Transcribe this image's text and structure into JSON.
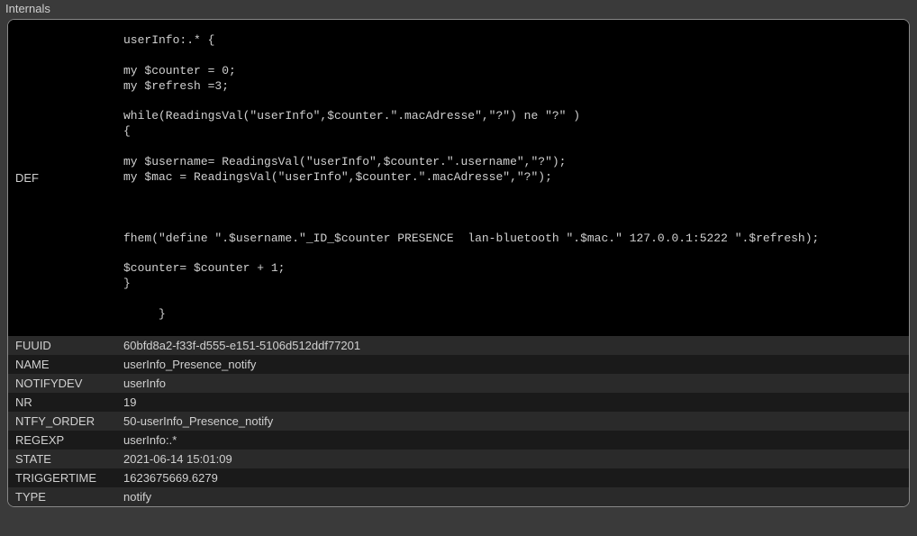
{
  "section_title": "Internals",
  "internals": {
    "def_label": "DEF",
    "def_code": "userInfo:.* {\n\nmy $counter = 0;\nmy $refresh =3;\n\nwhile(ReadingsVal(\"userInfo\",$counter.\".macAdresse\",\"?\") ne \"?\" )\n{\n\nmy $username= ReadingsVal(\"userInfo\",$counter.\".username\",\"?\");\nmy $mac = ReadingsVal(\"userInfo\",$counter.\".macAdresse\",\"?\");\n\n\n\nfhem(\"define \".$username.\"_ID_$counter PRESENCE  lan-bluetooth \".$mac.\" 127.0.0.1:5222 \".$refresh);\n\n$counter= $counter + 1;\n}\n\n     }",
    "rows": [
      {
        "label": "FUUID",
        "value": "60bfd8a2-f33f-d555-e151-5106d512ddf77201"
      },
      {
        "label": "NAME",
        "value": "userInfo_Presence_notify"
      },
      {
        "label": "NOTIFYDEV",
        "value": "userInfo"
      },
      {
        "label": "NR",
        "value": "19"
      },
      {
        "label": "NTFY_ORDER",
        "value": "50-userInfo_Presence_notify"
      },
      {
        "label": "REGEXP",
        "value": "userInfo:.*"
      },
      {
        "label": "STATE",
        "value": "2021-06-14 15:01:09"
      },
      {
        "label": "TRIGGERTIME",
        "value": "1623675669.6279"
      },
      {
        "label": "TYPE",
        "value": "notify"
      }
    ]
  }
}
